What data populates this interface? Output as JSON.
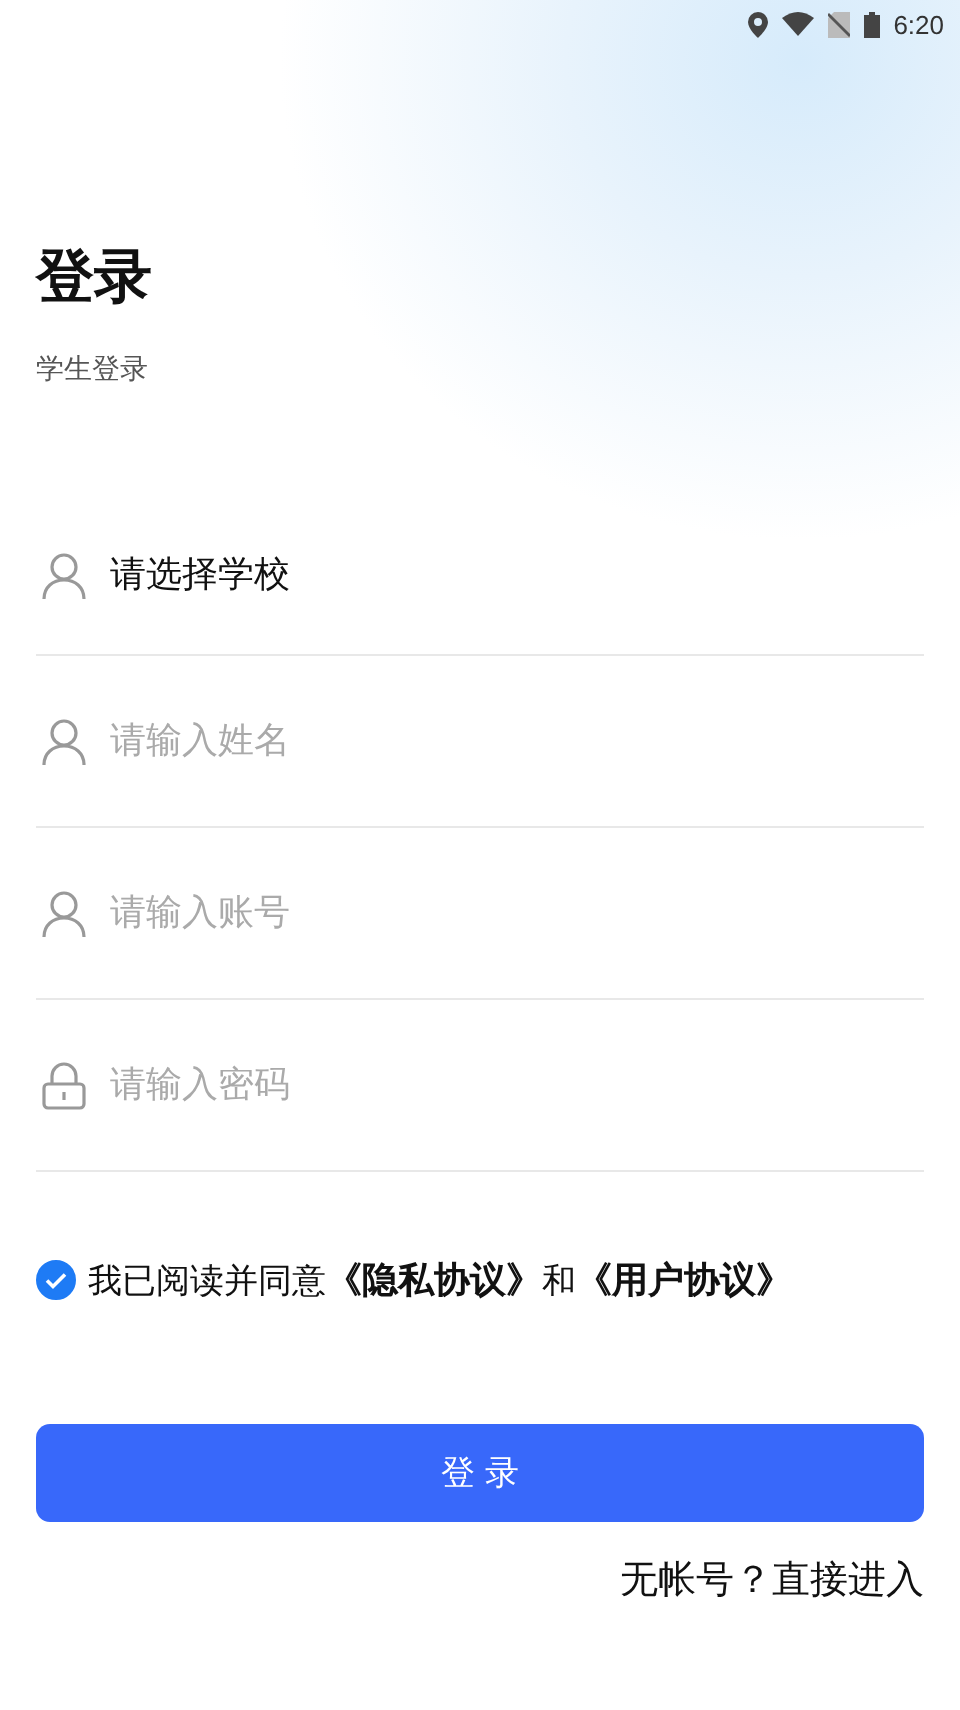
{
  "status_bar": {
    "time": "6:20"
  },
  "title": "登录",
  "subtitle": "学生登录",
  "fields": [
    {
      "kind": "person",
      "value": "请选择学校"
    },
    {
      "kind": "person",
      "placeholder": "请输入姓名"
    },
    {
      "kind": "person",
      "placeholder": "请输入账号"
    },
    {
      "kind": "lock",
      "placeholder": "请输入密码"
    }
  ],
  "agreement": {
    "checked": true,
    "text": "我已阅读并同意",
    "links": [
      "《隐私协议》",
      "《用户协议》"
    ],
    "joiner": "和"
  },
  "login_button": "登 录",
  "guest_link": "无帐号？直接进入"
}
